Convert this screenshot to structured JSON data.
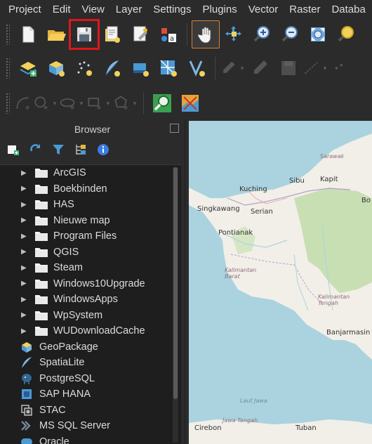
{
  "menubar": {
    "items": [
      {
        "label": "Project",
        "u": ""
      },
      {
        "label": "Edit",
        "u": "E"
      },
      {
        "label": "View",
        "u": ""
      },
      {
        "label": "Layer",
        "u": ""
      },
      {
        "label": "Settings",
        "u": ""
      },
      {
        "label": "Plugins",
        "u": "P"
      },
      {
        "label": "Vector",
        "u": ""
      },
      {
        "label": "Raster",
        "u": ""
      },
      {
        "label": "Databa",
        "u": ""
      }
    ]
  },
  "browser": {
    "title": "Browser",
    "folders": [
      "ArcGIS",
      "Boekbinden",
      "HAS",
      "Nieuwe map",
      "Program Files",
      "QGIS",
      "Steam",
      "Windows10Upgrade",
      "WindowsApps",
      "WpSystem",
      "WUDownloadCache"
    ],
    "providers": [
      "GeoPackage",
      "SpatiaLite",
      "PostgreSQL",
      "SAP HANA",
      "STAC",
      "MS SQL Server",
      "Oracle"
    ]
  },
  "map": {
    "labels": {
      "sarawak": "Sarawak",
      "sibu": "Sibu",
      "kapit": "Kapit",
      "kuching": "Kuching",
      "singkawang": "Singkawang",
      "serian": "Serian",
      "pontianak": "Pontianak",
      "kalbar": "Kalimantan\nBarat",
      "kalteng": "Kalimantan\nTengah",
      "banjarmasin": "Banjarmasin",
      "laut_jawa": "Laut Jawa",
      "jawa_tengah": "Jawa Tengah",
      "cirebon": "Cirebon",
      "tuban": "Tuban",
      "bo": "Bo"
    }
  },
  "colors": {
    "highlight": "#e0161b",
    "active_tool_border": "#d9822b",
    "panel_bg": "#2b2b2b",
    "tree_bg": "#1e1e1e",
    "sea": "#aad3df",
    "land": "#f2efe9",
    "forest": "#c8dfb4"
  }
}
